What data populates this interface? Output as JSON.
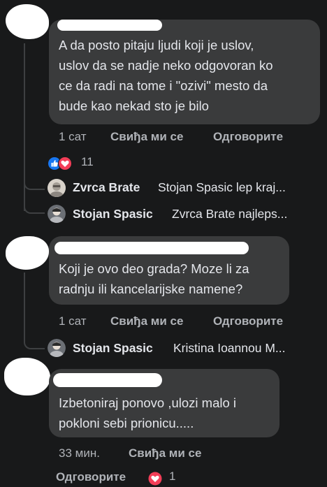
{
  "comments": [
    {
      "text": "A da posto pitaju ljudi koji je uslov,\nuslov da se nadje neko odgovoran ko\nce da radi na tome i \"ozivi\" mesto da\nbude kao nekad sto je bilo",
      "time": "1 сат",
      "like_label": "Свиђа ми се",
      "reply_label": "Одговорите",
      "reaction_count": "11",
      "reaction_icons": [
        "like-icon",
        "love-icon"
      ],
      "replies": [
        {
          "name": "Zvrca Brate",
          "snippet": "Stojan Spasic lep kraj..."
        },
        {
          "name": "Stojan Spasic",
          "snippet": "Zvrca Brate najleps..."
        }
      ]
    },
    {
      "text": "Koji je ovo deo grada? Moze li za\nradnju ili kancelarijske namene?",
      "time": "1 сат",
      "like_label": "Свиђа ми се",
      "reply_label": "Одговорите",
      "replies": [
        {
          "name": "Stojan Spasic",
          "snippet": "Kristina Ioannou M..."
        }
      ]
    },
    {
      "text": "Izbetoniraj ponovo ,ulozi malo i\npokloni sebi prionicu.....",
      "time": "33 мин.",
      "like_label": "Свиђа ми се",
      "reply_label": "Одговорите",
      "reaction_count": "1",
      "reaction_icons": [
        "love-icon"
      ]
    }
  ],
  "colors": {
    "background": "#18191a",
    "bubble": "#3a3b3c",
    "text": "#e4e6eb",
    "muted": "#b0b3b8",
    "like_blue": "#1877f2",
    "love_red": "#f33e58"
  }
}
